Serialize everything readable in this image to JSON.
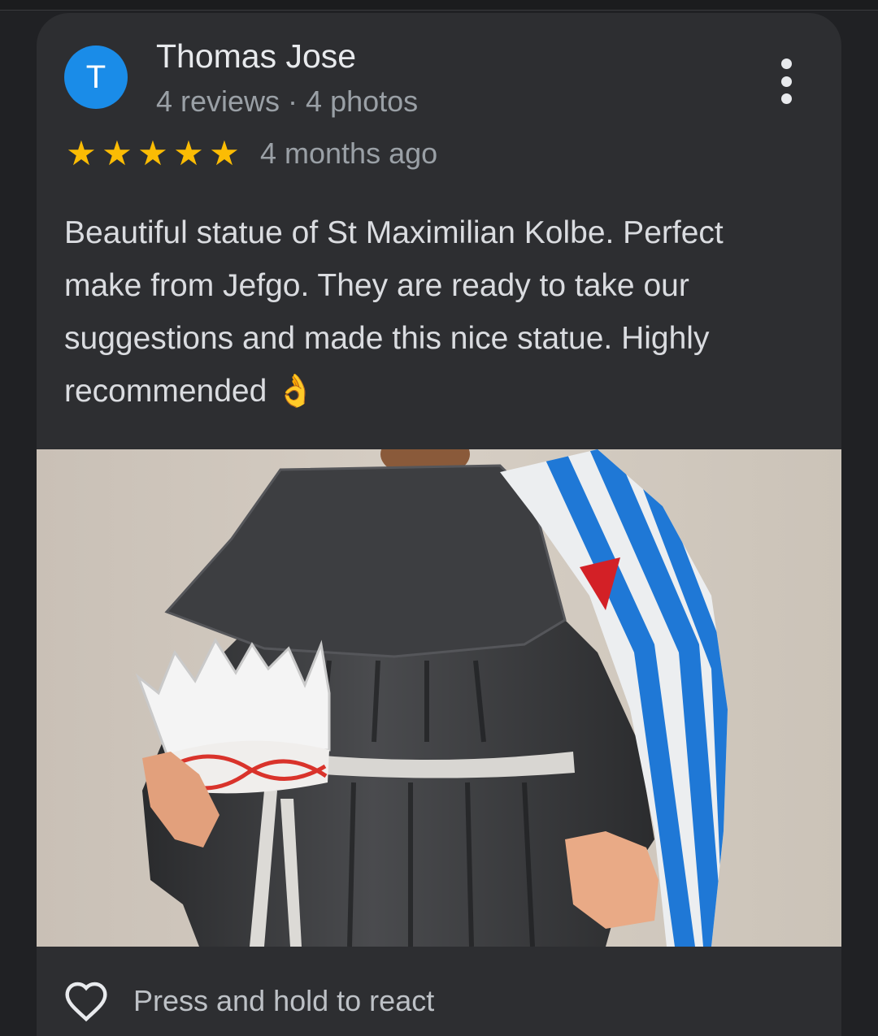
{
  "review": {
    "author": {
      "initial": "T",
      "name": "Thomas Jose",
      "meta": "4 reviews · 4 photos",
      "avatar_color": "#1a8ce8"
    },
    "rating": 5,
    "rating_max": 5,
    "star_color": "#fbbc04",
    "date": "4 months ago",
    "text": "Beautiful statue of St Maximilian Kolbe. Perfect make from Jefgo. They are ready to take our suggestions and made this nice statue. Highly recommended 👌",
    "more_icon": "more-vertical-icon",
    "photo_icon": "statue-photo"
  },
  "react": {
    "label": "Press and hold to react",
    "icon": "heart-outline-icon"
  }
}
